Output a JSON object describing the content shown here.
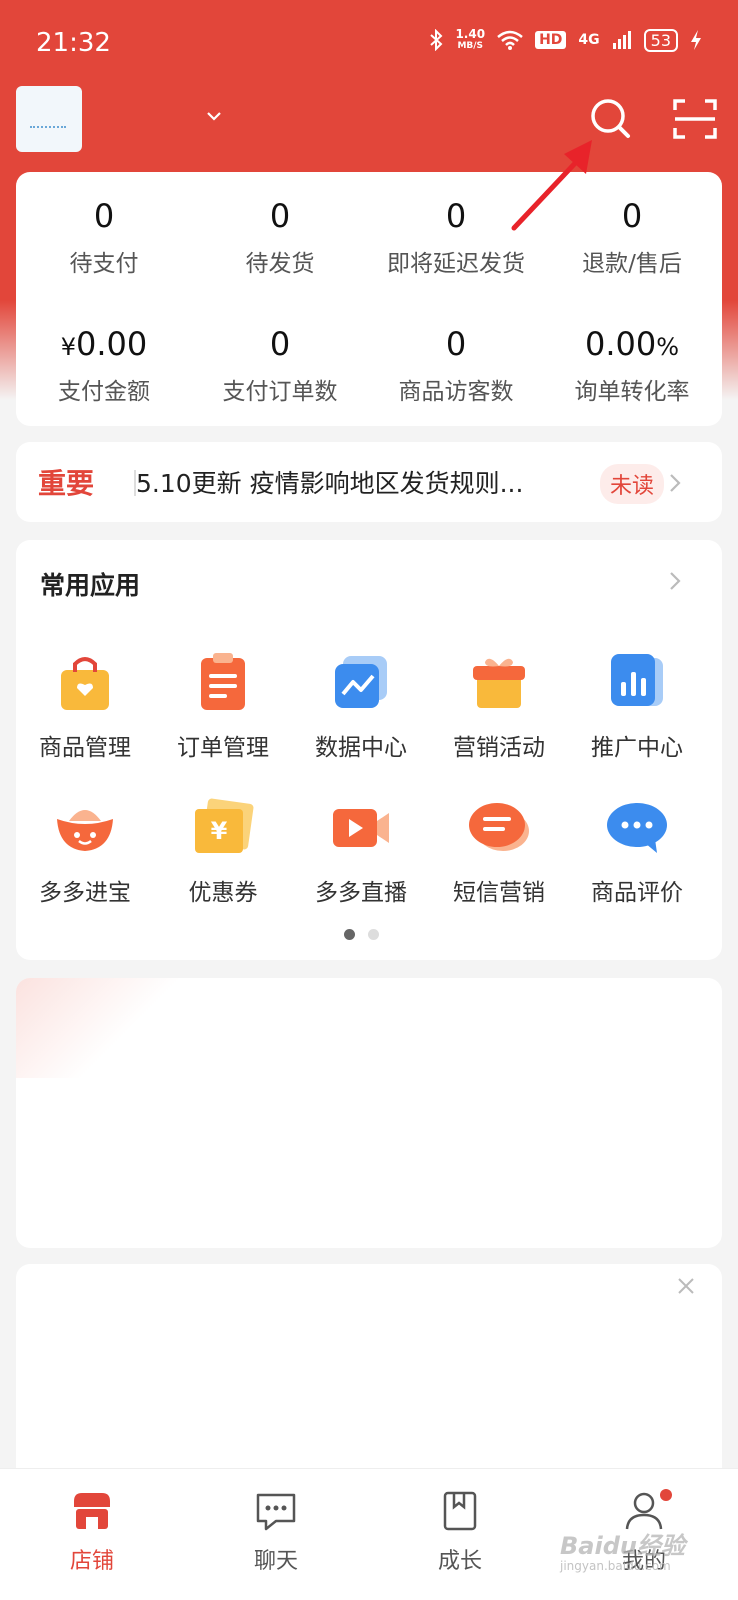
{
  "status_bar": {
    "time": "21:32",
    "speed_value": "1.40",
    "speed_unit": "MB/S",
    "hd": "HD",
    "network": "4G",
    "battery": "53"
  },
  "header": {
    "shop_name": "",
    "dropdown_icon": "chevron-down-icon",
    "search_icon": "search-icon",
    "scan_icon": "scan-icon"
  },
  "stats": [
    {
      "value": "0",
      "label": "待支付"
    },
    {
      "value": "0",
      "label": "待发货"
    },
    {
      "value": "0",
      "label": "即将延迟发货"
    },
    {
      "value": "0",
      "label": "退款/售后"
    },
    {
      "currency": "¥",
      "value": "0.00",
      "label": "支付金额"
    },
    {
      "value": "0",
      "label": "支付订单数"
    },
    {
      "value": "0",
      "label": "商品访客数"
    },
    {
      "value": "0.00",
      "unit": "%",
      "label": "询单转化率"
    }
  ],
  "notice": {
    "tag": "重要",
    "text": "5.10更新 疫情影响地区发货规则...",
    "badge": "未读"
  },
  "apps": {
    "title": "常用应用",
    "items": [
      {
        "label": "商品管理",
        "icon": "shopping-bag-icon"
      },
      {
        "label": "订单管理",
        "icon": "clipboard-icon"
      },
      {
        "label": "数据中心",
        "icon": "line-chart-icon"
      },
      {
        "label": "营销活动",
        "icon": "gift-box-icon"
      },
      {
        "label": "推广中心",
        "icon": "bar-chart-icon"
      },
      {
        "label": "多多进宝",
        "icon": "ingot-icon"
      },
      {
        "label": "优惠券",
        "icon": "coupon-icon"
      },
      {
        "label": "多多直播",
        "icon": "video-camera-icon"
      },
      {
        "label": "短信营销",
        "icon": "message-icon"
      },
      {
        "label": "商品评价",
        "icon": "chat-bubble-icon"
      }
    ],
    "page_count": 2,
    "active_page": 1
  },
  "tabbar": {
    "items": [
      {
        "label": "店铺",
        "icon": "store-icon",
        "active": true
      },
      {
        "label": "聊天",
        "icon": "chat-icon",
        "active": false
      },
      {
        "label": "成长",
        "icon": "book-icon",
        "active": false
      },
      {
        "label": "我的",
        "icon": "user-icon",
        "active": false
      }
    ]
  },
  "watermark": {
    "text": "Baidu经验",
    "sub": "jingyan.baidu.com"
  },
  "colors": {
    "brand_red": "#e2463a",
    "background": "#f4f4f4",
    "card": "#ffffff"
  }
}
